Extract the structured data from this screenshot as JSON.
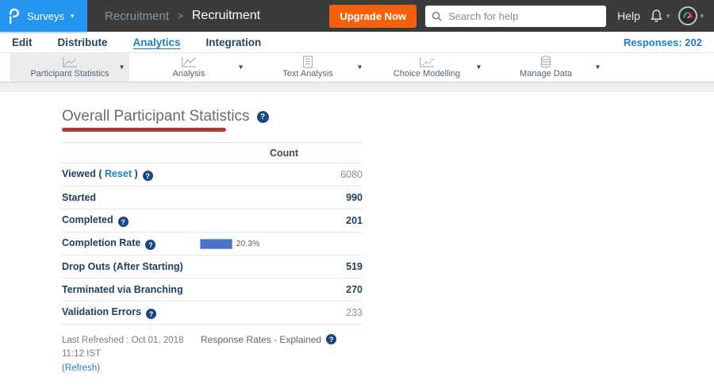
{
  "topbar": {
    "surveys_label": "Surveys",
    "breadcrumb": {
      "parent": "Recruitment",
      "separator": ">",
      "current": "Recruitment"
    },
    "upgrade_label": "Upgrade Now",
    "search_placeholder": "Search for help",
    "help_label": "Help"
  },
  "nav": {
    "items": [
      "Edit",
      "Distribute",
      "Analytics",
      "Integration"
    ],
    "active_item": "Analytics",
    "responses_label": "Responses: 202"
  },
  "toolbar": {
    "tabs": [
      {
        "label": "Participant Statistics",
        "icon": "line-chart-icon",
        "selected": true
      },
      {
        "label": "Analysis",
        "icon": "line-chart-icon",
        "selected": false
      },
      {
        "label": "Text Analysis",
        "icon": "document-icon",
        "selected": false
      },
      {
        "label": "Choice Modelling",
        "icon": "chart-icon",
        "selected": false
      },
      {
        "label": "Manage Data",
        "icon": "database-icon",
        "selected": false
      }
    ]
  },
  "content": {
    "title": "Overall Participant Statistics",
    "table": {
      "count_header": "Count",
      "rows": [
        {
          "label": "Viewed (",
          "link": "Reset",
          "label_suffix": ")",
          "help": true,
          "value": "6080",
          "value_style": "muted"
        },
        {
          "label": "Started",
          "help": false,
          "value": "990",
          "value_style": "bold"
        },
        {
          "label": "Completed",
          "help": true,
          "value": "201",
          "value_style": "bold"
        },
        {
          "label": "Completion Rate",
          "help": true,
          "bar": {
            "percent": 20.3,
            "label": "20.3%"
          }
        },
        {
          "label": "Drop Outs (After Starting)",
          "help": false,
          "value": "519",
          "value_style": "bold"
        },
        {
          "label": "Terminated via Branching",
          "help": false,
          "value": "270",
          "value_style": "bold"
        },
        {
          "label": "Validation Errors",
          "help": true,
          "value": "233",
          "value_style": "muted"
        }
      ]
    },
    "footer": {
      "last_refreshed": "Last Refreshed : Oct 01, 2018 11:12 IST",
      "refresh_link": "(Refresh)",
      "response_rates_label": "Response Rates - Explained"
    }
  },
  "colors": {
    "topbar_bg": "#3b3b3b",
    "brand_blue": "#2595f0",
    "upgrade_orange": "#f5600c",
    "link_blue": "#1f7dc0",
    "navy_text": "#1d3e5f",
    "bar_blue": "#4a72c8",
    "red_underline": "#b23a31"
  }
}
